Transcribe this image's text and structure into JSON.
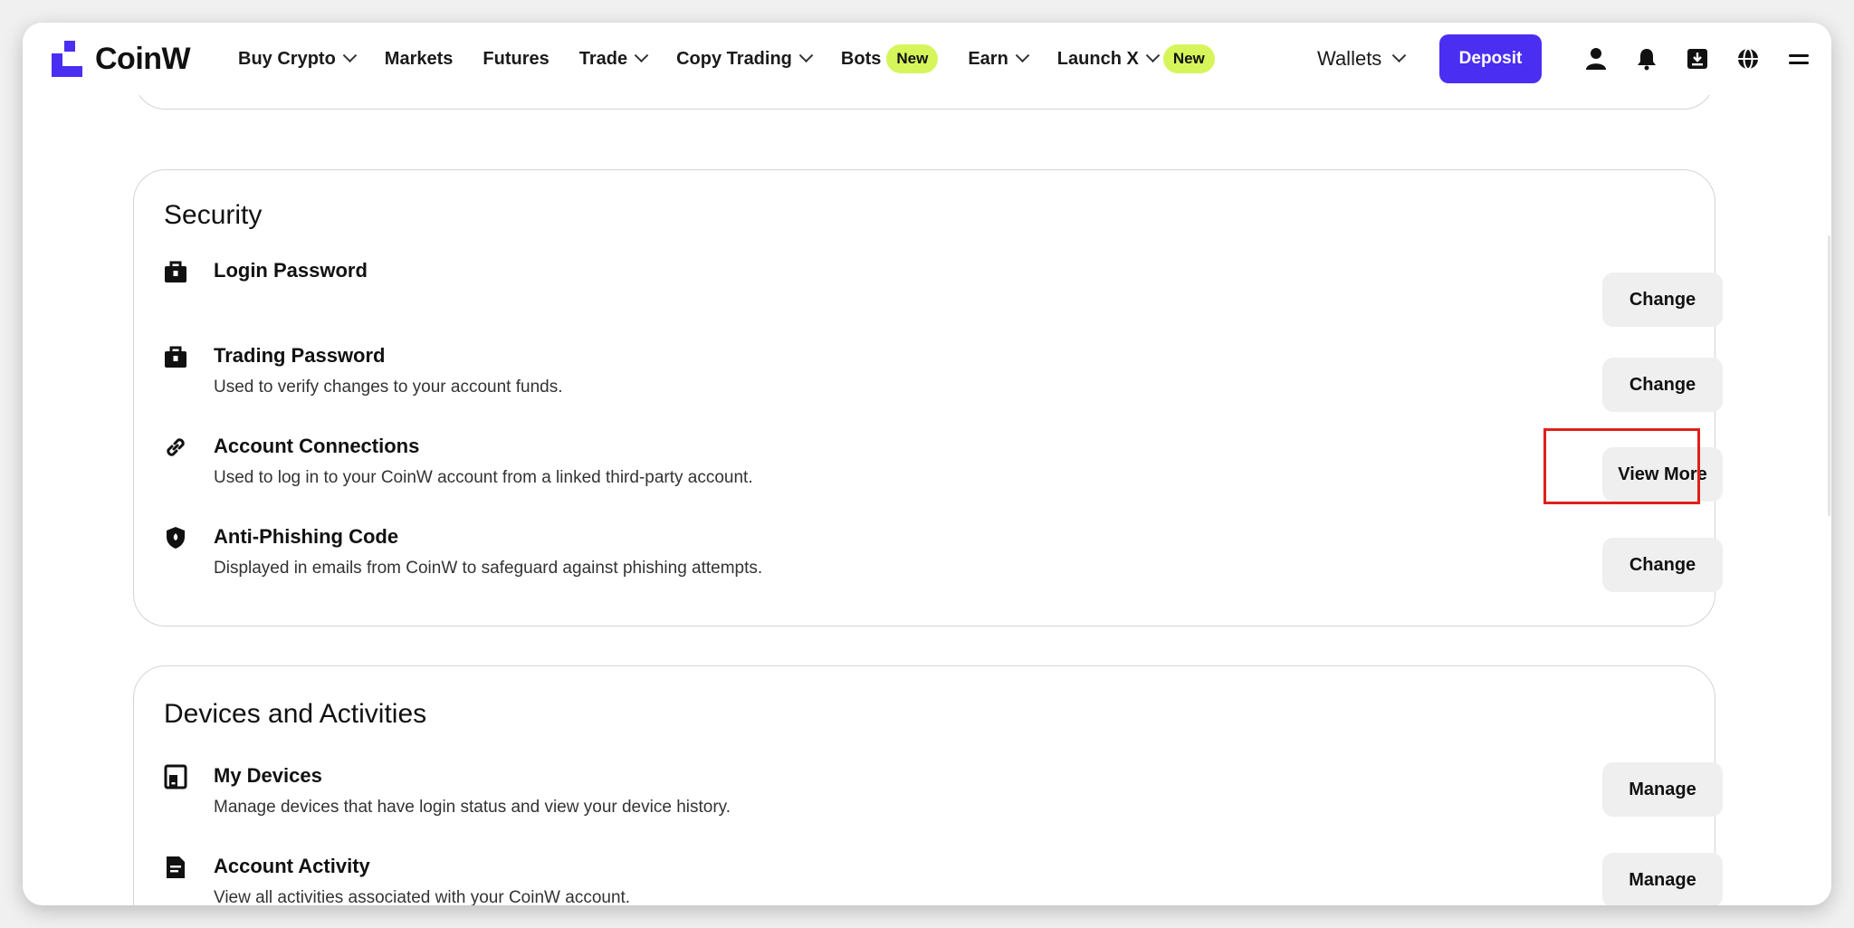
{
  "brand": {
    "name": "CoinW",
    "accent": "#4a2ef2",
    "badge_color": "#d6f55b",
    "highlight_color": "#e0201a"
  },
  "nav": {
    "items": [
      {
        "label": "Buy Crypto",
        "dropdown": true
      },
      {
        "label": "Markets"
      },
      {
        "label": "Futures"
      },
      {
        "label": "Trade",
        "dropdown": true
      },
      {
        "label": "Copy Trading",
        "dropdown": true
      },
      {
        "label": "Bots",
        "badge": "New"
      },
      {
        "label": "Earn",
        "dropdown": true
      },
      {
        "label": "Launch X",
        "dropdown": true,
        "badge": "New"
      }
    ],
    "wallets": "Wallets",
    "deposit": "Deposit",
    "icons": [
      "user-icon",
      "bell-icon",
      "download-icon",
      "globe-icon",
      "menu-icon"
    ]
  },
  "security": {
    "title": "Security",
    "rows": [
      {
        "icon": "briefcase-lock-icon",
        "title": "Login Password",
        "desc": "",
        "button": "Change"
      },
      {
        "icon": "briefcase-lock-icon",
        "title": "Trading Password",
        "desc": "Used to verify changes to your account funds.",
        "button": "Change"
      },
      {
        "icon": "link-icon",
        "title": "Account Connections",
        "desc": "Used to log in to your CoinW account from a linked third-party account.",
        "button": "View More"
      },
      {
        "icon": "shield-icon",
        "title": "Anti-Phishing Code",
        "desc": "Displayed in emails from CoinW to safeguard against phishing attempts.",
        "button": "Change"
      }
    ]
  },
  "devices": {
    "title": "Devices and Activities",
    "rows": [
      {
        "icon": "devices-icon",
        "title": "My Devices",
        "desc": "Manage devices that have login status and view your device history.",
        "button": "Manage"
      },
      {
        "icon": "document-icon",
        "title": "Account Activity",
        "desc": "View all activities associated with your CoinW account.",
        "button": "Manage"
      }
    ]
  }
}
